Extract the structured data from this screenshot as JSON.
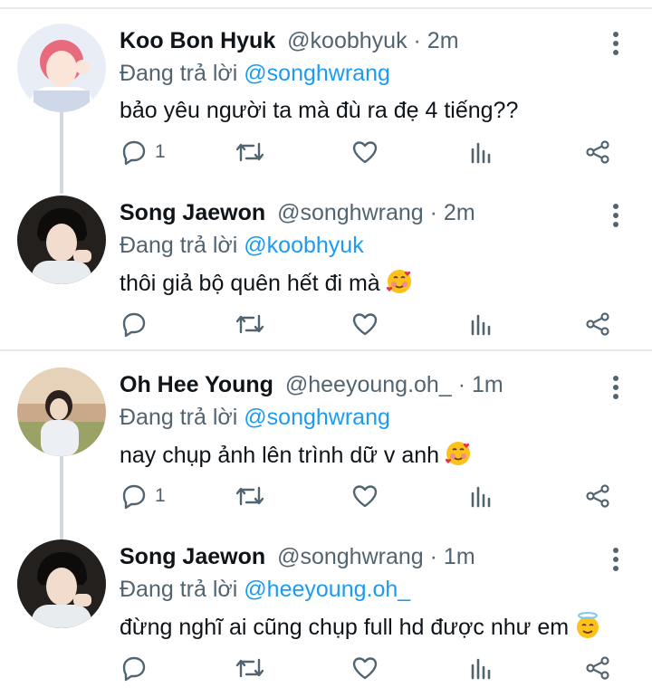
{
  "colors": {
    "accent": "#1d9bf0",
    "muted": "#536471",
    "divider": "#e7e9ea"
  },
  "tweets": [
    {
      "name": "Koo Bon Hyuk",
      "handle": "@koobhyuk",
      "time": "· 2m",
      "replying_label": "Đang trả lời",
      "replying_to": "@songhwrang",
      "text": "bảo yêu người ta mà đù ra đẹ 4 tiếng??",
      "emoji": "",
      "reply_count": "1"
    },
    {
      "name": "Song Jaewon",
      "handle": "@songhwrang",
      "time": "· 2m",
      "replying_label": "Đang trả lời",
      "replying_to": "@koobhyuk",
      "text": "thôi giả bộ quên hết đi mà",
      "emoji": "smiling-face-with-hearts",
      "reply_count": ""
    },
    {
      "name": "Oh Hee Young",
      "handle": "@heeyoung.oh_",
      "time": "· 1m",
      "replying_label": "Đang trả lời",
      "replying_to": "@songhwrang",
      "text": "nay chụp ảnh lên trình dữ v anh",
      "emoji": "smiling-face-with-hearts",
      "reply_count": "1"
    },
    {
      "name": "Song Jaewon",
      "handle": "@songhwrang",
      "time": "· 1m",
      "replying_label": "Đang trả lời",
      "replying_to": "@heeyoung.oh_",
      "text": "đừng nghĩ ai cũng chụp full hd được như em",
      "emoji": "smiling-face-with-halo",
      "reply_count": ""
    }
  ],
  "icons": [
    "reply-icon",
    "retweet-icon",
    "like-icon",
    "analytics-icon",
    "share-icon",
    "more-icon"
  ]
}
